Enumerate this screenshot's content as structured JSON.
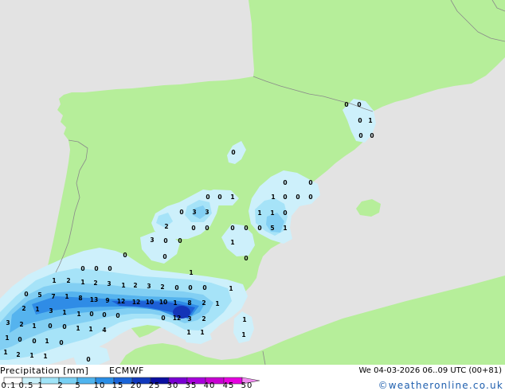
{
  "map": {
    "land_color": "#b6ee9a",
    "sea_color": "#e3e3e3",
    "precip_labels": [
      "0",
      "0",
      "0",
      "1",
      "0",
      "0",
      "0",
      "0",
      "0",
      "0",
      "0",
      "1",
      "1",
      "0",
      "0",
      "0",
      "0",
      "3",
      "3",
      "1",
      "1",
      "0",
      "2",
      "0",
      "0",
      "0",
      "0",
      "0",
      "5",
      "1",
      "3",
      "0",
      "0",
      "1",
      "0",
      "0",
      "0",
      "0",
      "0",
      "0",
      "1",
      "1",
      "2",
      "1",
      "2",
      "3",
      "1",
      "2",
      "3",
      "2",
      "0",
      "0",
      "0",
      "1",
      "0",
      "5",
      "7",
      "1",
      "8",
      "13",
      "9",
      "12",
      "12",
      "10",
      "10",
      "1",
      "8",
      "2",
      "1",
      "2",
      "1",
      "3",
      "1",
      "1",
      "0",
      "0",
      "0",
      "0",
      "12",
      "3",
      "2",
      "1",
      "3",
      "2",
      "1",
      "0",
      "0",
      "1",
      "1",
      "4",
      "1",
      "1",
      "1",
      "1",
      "0",
      "0",
      "1",
      "0",
      "1",
      "2",
      "1",
      "1",
      "0"
    ]
  },
  "legend": {
    "title": "Precipitation [mm]",
    "model": "ECMWF",
    "valid_time": "We 04-03-2026 06..09 UTC (00+81)",
    "ticks": [
      "0.1",
      "0.5",
      "1",
      "2",
      "5",
      "10",
      "15",
      "20",
      "25",
      "30",
      "35",
      "40",
      "45",
      "50"
    ],
    "colors": [
      "#ffffff",
      "#c8f0fa",
      "#a0e4f8",
      "#78d0f4",
      "#4fb4ee",
      "#2a8ee6",
      "#1a64d8",
      "#1038bc",
      "#0a0ea0",
      "#7800d2",
      "#a800dc",
      "#c800d2",
      "#e600e0"
    ],
    "overflow_color": "#f08cf0",
    "copyright": "©weatheronline.co.uk"
  }
}
